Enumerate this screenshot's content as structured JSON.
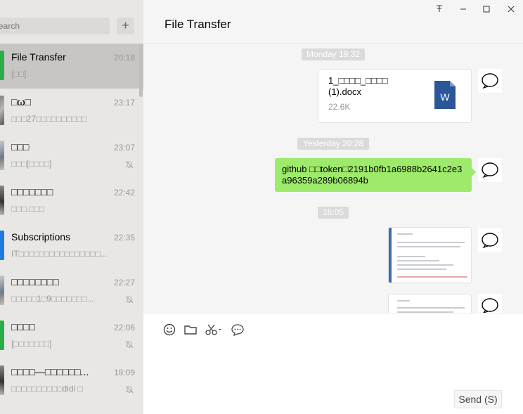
{
  "sidebar": {
    "search": {
      "placeholder": "earch"
    },
    "add_label": "+",
    "chats": [
      {
        "name": "File Transfer",
        "time": "20:18",
        "preview": "[□□]",
        "avatar": "green",
        "muted": false,
        "active": true
      },
      {
        "name": "□ω□",
        "time": "23:17",
        "preview": "□□□27□□□□□□□□□□",
        "avatar": "photo",
        "muted": false,
        "active": false
      },
      {
        "name": "□□□",
        "time": "23:07",
        "preview": "□□□[□□□□]",
        "avatar": "photo2",
        "muted": true,
        "active": false
      },
      {
        "name": "□□□□□□□",
        "time": "22:42",
        "preview": "□□□.□□□",
        "avatar": "photo3",
        "muted": false,
        "active": false
      },
      {
        "name": "Subscriptions",
        "time": "22:35",
        "preview": "IT□□□□□□□□□□□□□□□□...",
        "avatar": "blue",
        "muted": false,
        "active": false
      },
      {
        "name": "□□□□□□□□",
        "time": "22:27",
        "preview": "□□□□□1□9□□□□□□□...",
        "avatar": "photo2",
        "muted": true,
        "active": false
      },
      {
        "name": "□□□□",
        "time": "22:06",
        "preview": "[□□□□□□□]",
        "avatar": "green",
        "muted": true,
        "active": false
      },
      {
        "name": "□□□□—□□□□□□...",
        "time": "18:09",
        "preview": "□□□□□□□□□□didi □",
        "avatar": "photo3",
        "muted": true,
        "active": false
      }
    ]
  },
  "header": {
    "title": "File Transfer",
    "controls": {
      "pin": "ꟷ",
      "minimize": "—",
      "maximize": "☐",
      "close": "✕"
    }
  },
  "messages": {
    "ts1": "Monday 19:32",
    "file": {
      "name": "1_□□□□_□□□□ (1).docx",
      "size": "22.6K",
      "icon": "word-doc-icon"
    },
    "ts2": "Yesterday 20:28",
    "text": "github □□token□2191b0fb1a6988b2641c2e3a96359a289b06894b",
    "ts3": "16:05"
  },
  "input": {
    "send_label": "Send (S)",
    "tools": [
      "emoji-icon",
      "folder-icon",
      "scissors-icon",
      "chat-bubble-icon"
    ]
  },
  "colors": {
    "accent_green": "#2aae4a",
    "bubble_green": "#9eea6a",
    "sidebar_bg": "#e8e7e6",
    "active_item": "#c7c6c5"
  }
}
